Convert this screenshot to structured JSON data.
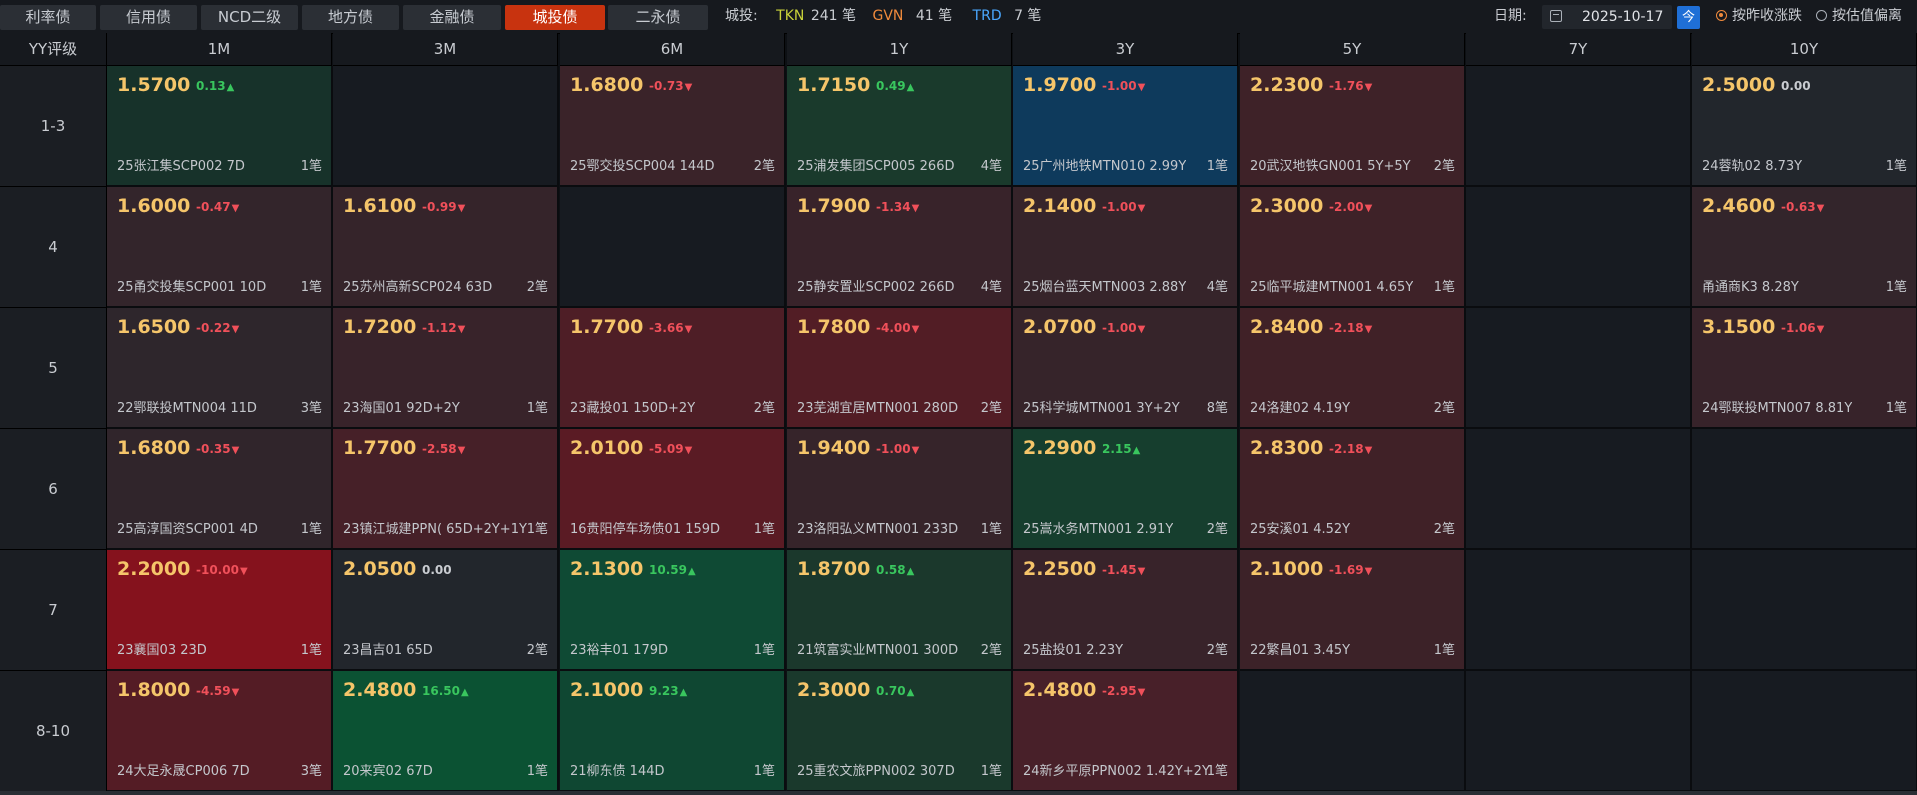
{
  "tabs": [
    {
      "label": "利率债",
      "active": false
    },
    {
      "label": "信用债",
      "active": false
    },
    {
      "label": "NCD二级",
      "active": false
    },
    {
      "label": "地方债",
      "active": false
    },
    {
      "label": "金融债",
      "active": false
    },
    {
      "label": "城投债",
      "active": true
    },
    {
      "label": "二永债",
      "active": false
    }
  ],
  "summary": {
    "prefix": "城投:",
    "tkn_label": "TKN",
    "tkn_count": "241 笔",
    "gvn_label": "GVN",
    "gvn_count": "41 笔",
    "trd_label": "TRD",
    "trd_count": "7 笔"
  },
  "date": {
    "label": "日期:",
    "value": "2025-10-17",
    "today_label": "今"
  },
  "radios": [
    {
      "label": "按昨收涨跌",
      "selected": true
    },
    {
      "label": "按估值偏离",
      "selected": false
    }
  ],
  "colors": {
    "accent": "#c8330f",
    "tkn": "#c9d23a",
    "gvn": "#f08a3c",
    "trd": "#4aa8ff",
    "rate": "#f5c56a",
    "up": "#39c65e",
    "down": "#f0505a"
  },
  "grid": {
    "corner_label": "YY评级",
    "columns": [
      "1M",
      "3M",
      "6M",
      "1Y",
      "3Y",
      "5Y",
      "7Y",
      "10Y"
    ],
    "rows": [
      {
        "label": "1-3",
        "cells": [
          {
            "rate": "1.5700",
            "chg": "0.13",
            "dir": "up",
            "bond": "25张江集SCP002 7D",
            "count": "1笔",
            "bg": "#17322a"
          },
          null,
          {
            "rate": "1.6800",
            "chg": "-0.73",
            "dir": "down",
            "bond": "25鄂交投SCP004 144D",
            "count": "2笔",
            "bg": "#3a2329"
          },
          {
            "rate": "1.7150",
            "chg": "0.49",
            "dir": "up",
            "bond": "25浦发集团SCP005 266D",
            "count": "4笔",
            "bg": "#1a3a2c"
          },
          {
            "rate": "1.9700",
            "chg": "-1.00",
            "dir": "down",
            "bond": "25广州地铁MTN010 2.99Y",
            "count": "1笔",
            "bg": "#0e3a5c"
          },
          {
            "rate": "2.2300",
            "chg": "-1.76",
            "dir": "down",
            "bond": "20武汉地铁GN001 5Y+5Y",
            "count": "2笔",
            "bg": "#3e2228"
          },
          null,
          {
            "rate": "2.5000",
            "chg": "0.00",
            "dir": "flat",
            "bond": "24蓉轨02 8.73Y",
            "count": "1笔",
            "bg": "#22262c"
          }
        ]
      },
      {
        "label": "4",
        "cells": [
          {
            "rate": "1.6000",
            "chg": "-0.47",
            "dir": "down",
            "bond": "25甬交投集SCP001 10D",
            "count": "1笔",
            "bg": "#33252b"
          },
          {
            "rate": "1.6100",
            "chg": "-0.99",
            "dir": "down",
            "bond": "25苏州高新SCP024 63D",
            "count": "2笔",
            "bg": "#35242a"
          },
          null,
          {
            "rate": "1.7900",
            "chg": "-1.34",
            "dir": "down",
            "bond": "25静安置业SCP002 266D",
            "count": "4笔",
            "bg": "#38232a"
          },
          {
            "rate": "2.1400",
            "chg": "-1.00",
            "dir": "down",
            "bond": "25烟台蓝天MTN003 2.88Y",
            "count": "4笔",
            "bg": "#36242a"
          },
          {
            "rate": "2.3000",
            "chg": "-2.00",
            "dir": "down",
            "bond": "25临平城建MTN001 4.65Y",
            "count": "1笔",
            "bg": "#3e2228"
          },
          null,
          {
            "rate": "2.4600",
            "chg": "-0.63",
            "dir": "down",
            "bond": "甬通商K3 8.28Y",
            "count": "1笔",
            "bg": "#33252b"
          }
        ]
      },
      {
        "label": "5",
        "cells": [
          {
            "rate": "1.6500",
            "chg": "-0.22",
            "dir": "down",
            "bond": "22鄂联投MTN004 11D",
            "count": "3笔",
            "bg": "#2e262c"
          },
          {
            "rate": "1.7200",
            "chg": "-1.12",
            "dir": "down",
            "bond": "23海国01 92D+2Y",
            "count": "1笔",
            "bg": "#38232a"
          },
          {
            "rate": "1.7700",
            "chg": "-3.66",
            "dir": "down",
            "bond": "23藏投01 150D+2Y",
            "count": "2笔",
            "bg": "#4e1e26"
          },
          {
            "rate": "1.7800",
            "chg": "-4.00",
            "dir": "down",
            "bond": "23芜湖宜居MTN001 280D",
            "count": "2笔",
            "bg": "#521d25"
          },
          {
            "rate": "2.0700",
            "chg": "-1.00",
            "dir": "down",
            "bond": "25科学城MTN001 3Y+2Y",
            "count": "8笔",
            "bg": "#36242a"
          },
          {
            "rate": "2.8400",
            "chg": "-2.18",
            "dir": "down",
            "bond": "24洛建02 4.19Y",
            "count": "2笔",
            "bg": "#402127"
          },
          null,
          {
            "rate": "3.1500",
            "chg": "-1.06",
            "dir": "down",
            "bond": "24鄂联投MTN007 8.81Y",
            "count": "1笔",
            "bg": "#37232a"
          }
        ]
      },
      {
        "label": "6",
        "cells": [
          {
            "rate": "1.6800",
            "chg": "-0.35",
            "dir": "down",
            "bond": "25高淳国资SCP001 4D",
            "count": "1笔",
            "bg": "#30252b"
          },
          {
            "rate": "1.7700",
            "chg": "-2.58",
            "dir": "down",
            "bond": "23镇江城建PPN( 65D+2Y+1Y",
            "count": "1笔",
            "bg": "#462028"
          },
          {
            "rate": "2.0100",
            "chg": "-5.09",
            "dir": "down",
            "bond": "16贵阳停车场债01 159D",
            "count": "1笔",
            "bg": "#5a1b24"
          },
          {
            "rate": "1.9400",
            "chg": "-1.00",
            "dir": "down",
            "bond": "23洛阳弘义MTN001 233D",
            "count": "1笔",
            "bg": "#36242a"
          },
          {
            "rate": "2.2900",
            "chg": "2.15",
            "dir": "up",
            "bond": "25嵩水务MTN001 2.91Y",
            "count": "2笔",
            "bg": "#163e2e"
          },
          {
            "rate": "2.8300",
            "chg": "-2.18",
            "dir": "down",
            "bond": "25安溪01 4.52Y",
            "count": "2笔",
            "bg": "#402127"
          },
          null,
          null
        ]
      },
      {
        "label": "7",
        "cells": [
          {
            "rate": "2.2000",
            "chg": "-10.00",
            "dir": "down",
            "bond": "23襄国03 23D",
            "count": "1笔",
            "bg": "#85121d"
          },
          {
            "rate": "2.0500",
            "chg": "0.00",
            "dir": "flat",
            "bond": "23昌吉01 65D",
            "count": "2笔",
            "bg": "#22262c"
          },
          {
            "rate": "2.1300",
            "chg": "10.59",
            "dir": "up",
            "bond": "23裕丰01 179D",
            "count": "1笔",
            "bg": "#0f4a34"
          },
          {
            "rate": "1.8700",
            "chg": "0.58",
            "dir": "up",
            "bond": "21筑富实业MTN001 300D",
            "count": "2笔",
            "bg": "#1b382c"
          },
          {
            "rate": "2.2500",
            "chg": "-1.45",
            "dir": "down",
            "bond": "25盐投01 2.23Y",
            "count": "2笔",
            "bg": "#38232a"
          },
          {
            "rate": "2.1000",
            "chg": "-1.69",
            "dir": "down",
            "bond": "22繁昌01 3.45Y",
            "count": "1笔",
            "bg": "#3c2228"
          },
          null,
          null
        ]
      },
      {
        "label": "8-10",
        "cells": [
          {
            "rate": "1.8000",
            "chg": "-4.59",
            "dir": "down",
            "bond": "24大足永晟CP006 7D",
            "count": "3笔",
            "bg": "#541c25"
          },
          {
            "rate": "2.4800",
            "chg": "16.50",
            "dir": "up",
            "bond": "20来宾02 67D",
            "count": "1笔",
            "bg": "#0b5233"
          },
          {
            "rate": "2.1000",
            "chg": "9.23",
            "dir": "up",
            "bond": "21柳东债 144D",
            "count": "1笔",
            "bg": "#0f4732"
          },
          {
            "rate": "2.3000",
            "chg": "0.70",
            "dir": "up",
            "bond": "25重农文旅PPN002 307D",
            "count": "1笔",
            "bg": "#1a392c"
          },
          {
            "rate": "2.4800",
            "chg": "-2.95",
            "dir": "down",
            "bond": "24新乡平原PPN002 1.42Y+2Y",
            "count": "1笔",
            "bg": "#482029"
          },
          null,
          null,
          null
        ]
      }
    ]
  }
}
